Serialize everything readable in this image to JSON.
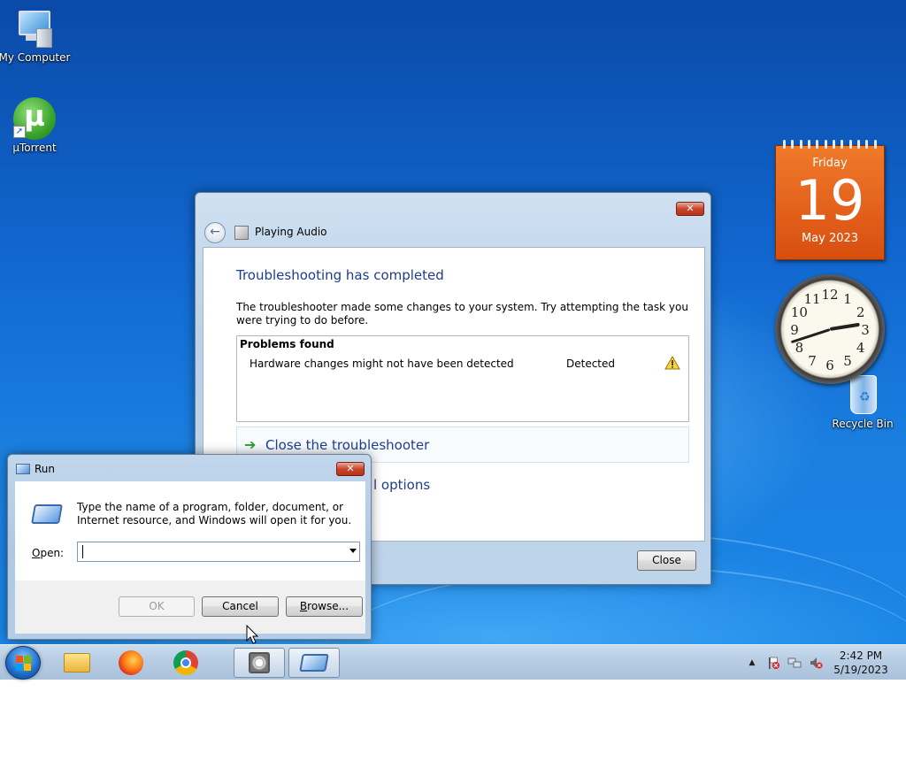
{
  "desktop": {
    "icons": [
      {
        "label": "My Computer",
        "icon": "computer-icon"
      },
      {
        "label": "µTorrent",
        "icon": "utorrent-icon"
      },
      {
        "label": "Recycle Bin",
        "icon": "recycle-bin-icon"
      }
    ],
    "calendar_gadget": {
      "weekday": "Friday",
      "day": "19",
      "month_year": "May 2023"
    },
    "clock_gadget": {
      "numerals": [
        "12",
        "1",
        "2",
        "3",
        "4",
        "5",
        "6",
        "7",
        "8",
        "9",
        "10",
        "11"
      ],
      "hour": 14,
      "minute": 42
    }
  },
  "troubleshooter": {
    "close_glyph": "✕",
    "header_title": "Playing Audio",
    "heading": "Troubleshooting has completed",
    "description": "The troubleshooter made some changes to your system. Try attempting the task you were trying to do before.",
    "problems_title": "Problems found",
    "problems": [
      {
        "text": "Hardware changes might not have been detected",
        "status": "Detected",
        "icon": "warning-icon"
      }
    ],
    "close_link": "Close the troubleshooter",
    "options_link_partial": "l options",
    "close_button": "Close"
  },
  "run_dialog": {
    "title": "Run",
    "close_glyph": "✕",
    "description": "Type the name of a program, folder, document, or Internet resource, and Windows will open it for you.",
    "open_label_underlined": "O",
    "open_label_rest": "pen:",
    "open_value": "",
    "ok_label": "OK",
    "cancel_label": "Cancel",
    "browse_label_underlined": "B",
    "browse_label_rest": "rowse..."
  },
  "taskbar": {
    "pinned": [
      "windows-explorer-icon",
      "firefox-icon",
      "chrome-icon",
      "troubleshooter-icon",
      "run-icon"
    ],
    "tray_chevron": "▲",
    "time": "2:42 PM",
    "date": "5/19/2023"
  },
  "colors": {
    "calendar": "#e2601b",
    "link_blue": "#1e3d8f",
    "close_button_red": "#c9452a"
  }
}
